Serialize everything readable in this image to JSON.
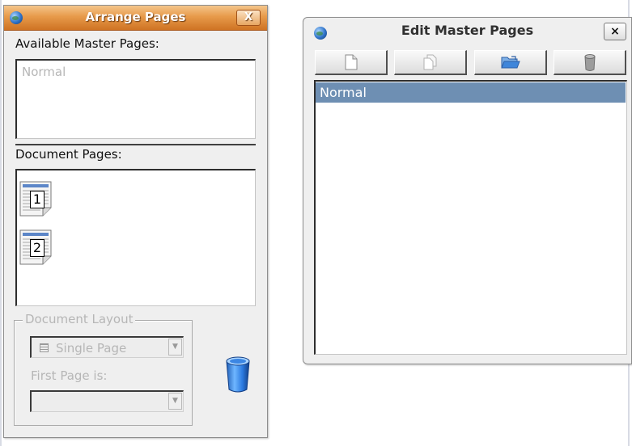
{
  "arrange_pages": {
    "title": "Arrange Pages",
    "close_label": "X",
    "available_master_pages_label": "Available Master Pages:",
    "master_pages": [
      "Normal"
    ],
    "document_pages_label": "Document Pages:",
    "document_pages": [
      "1",
      "2"
    ],
    "document_layout": {
      "group_title": "Document Layout",
      "layout_value": "Single Page",
      "layout_icon": "single-page-icon",
      "first_page_label": "First Page is:",
      "first_page_value": ""
    },
    "trash_icon": "trash-icon"
  },
  "edit_master_pages": {
    "title": "Edit Master Pages",
    "close_label": "×",
    "toolbar": [
      {
        "name": "new-page",
        "icon": "new-page-icon"
      },
      {
        "name": "duplicate-page",
        "icon": "duplicate-page-icon"
      },
      {
        "name": "import-page",
        "icon": "open-folder-icon"
      },
      {
        "name": "delete-page",
        "icon": "trash-icon"
      }
    ],
    "master_pages": [
      "Normal"
    ],
    "selected_master_page": "Normal"
  },
  "colors": {
    "titlebar_orange": "#e79a4a",
    "selection_blue": "#6e8fb3",
    "window_background": "#efefef"
  }
}
